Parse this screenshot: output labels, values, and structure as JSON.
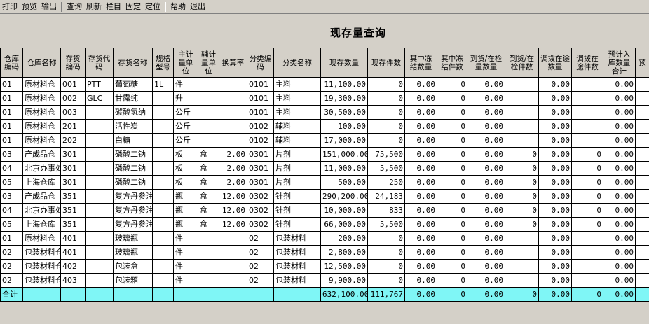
{
  "toolbar": [
    {
      "label": "打印",
      "name": "print-button"
    },
    {
      "label": "预览",
      "name": "preview-button"
    },
    {
      "label": "输出",
      "name": "export-button"
    },
    {
      "sep": true
    },
    {
      "label": "查询",
      "name": "query-button"
    },
    {
      "label": "刷新",
      "name": "refresh-button"
    },
    {
      "label": "栏目",
      "name": "columns-button"
    },
    {
      "label": "固定",
      "name": "freeze-button"
    },
    {
      "label": "定位",
      "name": "locate-button"
    },
    {
      "sep": true
    },
    {
      "label": "帮助",
      "name": "help-button"
    },
    {
      "label": "退出",
      "name": "exit-button"
    }
  ],
  "title": "现存量查询",
  "columns": [
    "仓库编码",
    "仓库名称",
    "存货编码",
    "存货代码",
    "存货名称",
    "规格型号",
    "主计量单位",
    "辅计量单位",
    "换算率",
    "分类编码",
    "分类名称",
    "现存数量",
    "现存件数",
    "其中冻结数量",
    "其中冻结件数",
    "到货/在检量数量",
    "到货/在检件数",
    "调拨在途数量",
    "调拨在途件数",
    "预计入库数量合计",
    "预"
  ],
  "rows": [
    [
      "01",
      "原材料仓",
      "001",
      "PTT",
      "葡萄糖",
      "1L",
      "件",
      "",
      "",
      "0101",
      "主料",
      "11,100.00",
      "0",
      "0.00",
      "0",
      "0.00",
      "",
      "0.00",
      "",
      "0.00",
      ""
    ],
    [
      "01",
      "原材料仓",
      "002",
      "GLC",
      "甘露纯",
      "",
      "升",
      "",
      "",
      "0101",
      "主料",
      "19,300.00",
      "0",
      "0.00",
      "0",
      "0.00",
      "",
      "0.00",
      "",
      "0.00",
      ""
    ],
    [
      "01",
      "原材料仓",
      "003",
      "",
      "碳酸氢纳",
      "",
      "公斤",
      "",
      "",
      "0101",
      "主料",
      "30,500.00",
      "0",
      "0.00",
      "0",
      "0.00",
      "",
      "0.00",
      "",
      "0.00",
      ""
    ],
    [
      "01",
      "原材料仓",
      "201",
      "",
      "活性炭",
      "",
      "公斤",
      "",
      "",
      "0102",
      "辅料",
      "100.00",
      "0",
      "0.00",
      "0",
      "0.00",
      "",
      "0.00",
      "",
      "0.00",
      ""
    ],
    [
      "01",
      "原材料仓",
      "202",
      "",
      "白糖",
      "",
      "公斤",
      "",
      "",
      "0102",
      "辅料",
      "17,000.00",
      "0",
      "0.00",
      "0",
      "0.00",
      "",
      "0.00",
      "",
      "0.00",
      ""
    ],
    [
      "03",
      "产成品仓",
      "301",
      "",
      "磷酸二钠",
      "",
      "板",
      "盒",
      "2.00",
      "0301",
      "片剂",
      "151,000.00",
      "75,500",
      "0.00",
      "0",
      "0.00",
      "0",
      "0.00",
      "0",
      "0.00",
      ""
    ],
    [
      "04",
      "北京办事处仓库",
      "301",
      "",
      "磷酸二钠",
      "",
      "板",
      "盒",
      "2.00",
      "0301",
      "片剂",
      "11,000.00",
      "5,500",
      "0.00",
      "0",
      "0.00",
      "0",
      "0.00",
      "0",
      "0.00",
      ""
    ],
    [
      "05",
      "上海仓库",
      "301",
      "",
      "磷酸二钠",
      "",
      "板",
      "盒",
      "2.00",
      "0301",
      "片剂",
      "500.00",
      "250",
      "0.00",
      "0",
      "0.00",
      "0",
      "0.00",
      "0",
      "0.00",
      ""
    ],
    [
      "03",
      "产成品仓",
      "351",
      "",
      "复方丹参注射液",
      "",
      "瓶",
      "盒",
      "12.00",
      "0302",
      "针剂",
      "290,200.00",
      "24,183",
      "0.00",
      "0",
      "0.00",
      "0",
      "0.00",
      "0",
      "0.00",
      ""
    ],
    [
      "04",
      "北京办事处仓库",
      "351",
      "",
      "复方丹参注射液",
      "",
      "瓶",
      "盒",
      "12.00",
      "0302",
      "针剂",
      "10,000.00",
      "833",
      "0.00",
      "0",
      "0.00",
      "0",
      "0.00",
      "0",
      "0.00",
      ""
    ],
    [
      "05",
      "上海仓库",
      "351",
      "",
      "复方丹参注射液",
      "",
      "瓶",
      "盒",
      "12.00",
      "0302",
      "针剂",
      "66,000.00",
      "5,500",
      "0.00",
      "0",
      "0.00",
      "0",
      "0.00",
      "0",
      "0.00",
      ""
    ],
    [
      "01",
      "原材料仓",
      "401",
      "",
      "玻璃瓶",
      "",
      "件",
      "",
      "",
      "02",
      "包装材料",
      "200.00",
      "0",
      "0.00",
      "0",
      "0.00",
      "",
      "0.00",
      "",
      "0.00",
      ""
    ],
    [
      "02",
      "包装材料仓",
      "401",
      "",
      "玻璃瓶",
      "",
      "件",
      "",
      "",
      "02",
      "包装材料",
      "2,800.00",
      "0",
      "0.00",
      "0",
      "0.00",
      "",
      "0.00",
      "",
      "0.00",
      ""
    ],
    [
      "02",
      "包装材料仓",
      "402",
      "",
      "包装盒",
      "",
      "件",
      "",
      "",
      "02",
      "包装材料",
      "12,500.00",
      "0",
      "0.00",
      "0",
      "0.00",
      "",
      "0.00",
      "",
      "0.00",
      ""
    ],
    [
      "02",
      "包装材料仓",
      "403",
      "",
      "包装箱",
      "",
      "件",
      "",
      "",
      "02",
      "包装材料",
      "9,900.00",
      "0",
      "0.00",
      "0",
      "0.00",
      "",
      "0.00",
      "",
      "0.00",
      ""
    ]
  ],
  "total": [
    "合计",
    "",
    "",
    "",
    "",
    "",
    "",
    "",
    "",
    "",
    "",
    "632,100.00",
    "111,767",
    "0.00",
    "0",
    "0.00",
    "0",
    "0.00",
    "0",
    "0.00",
    ""
  ]
}
